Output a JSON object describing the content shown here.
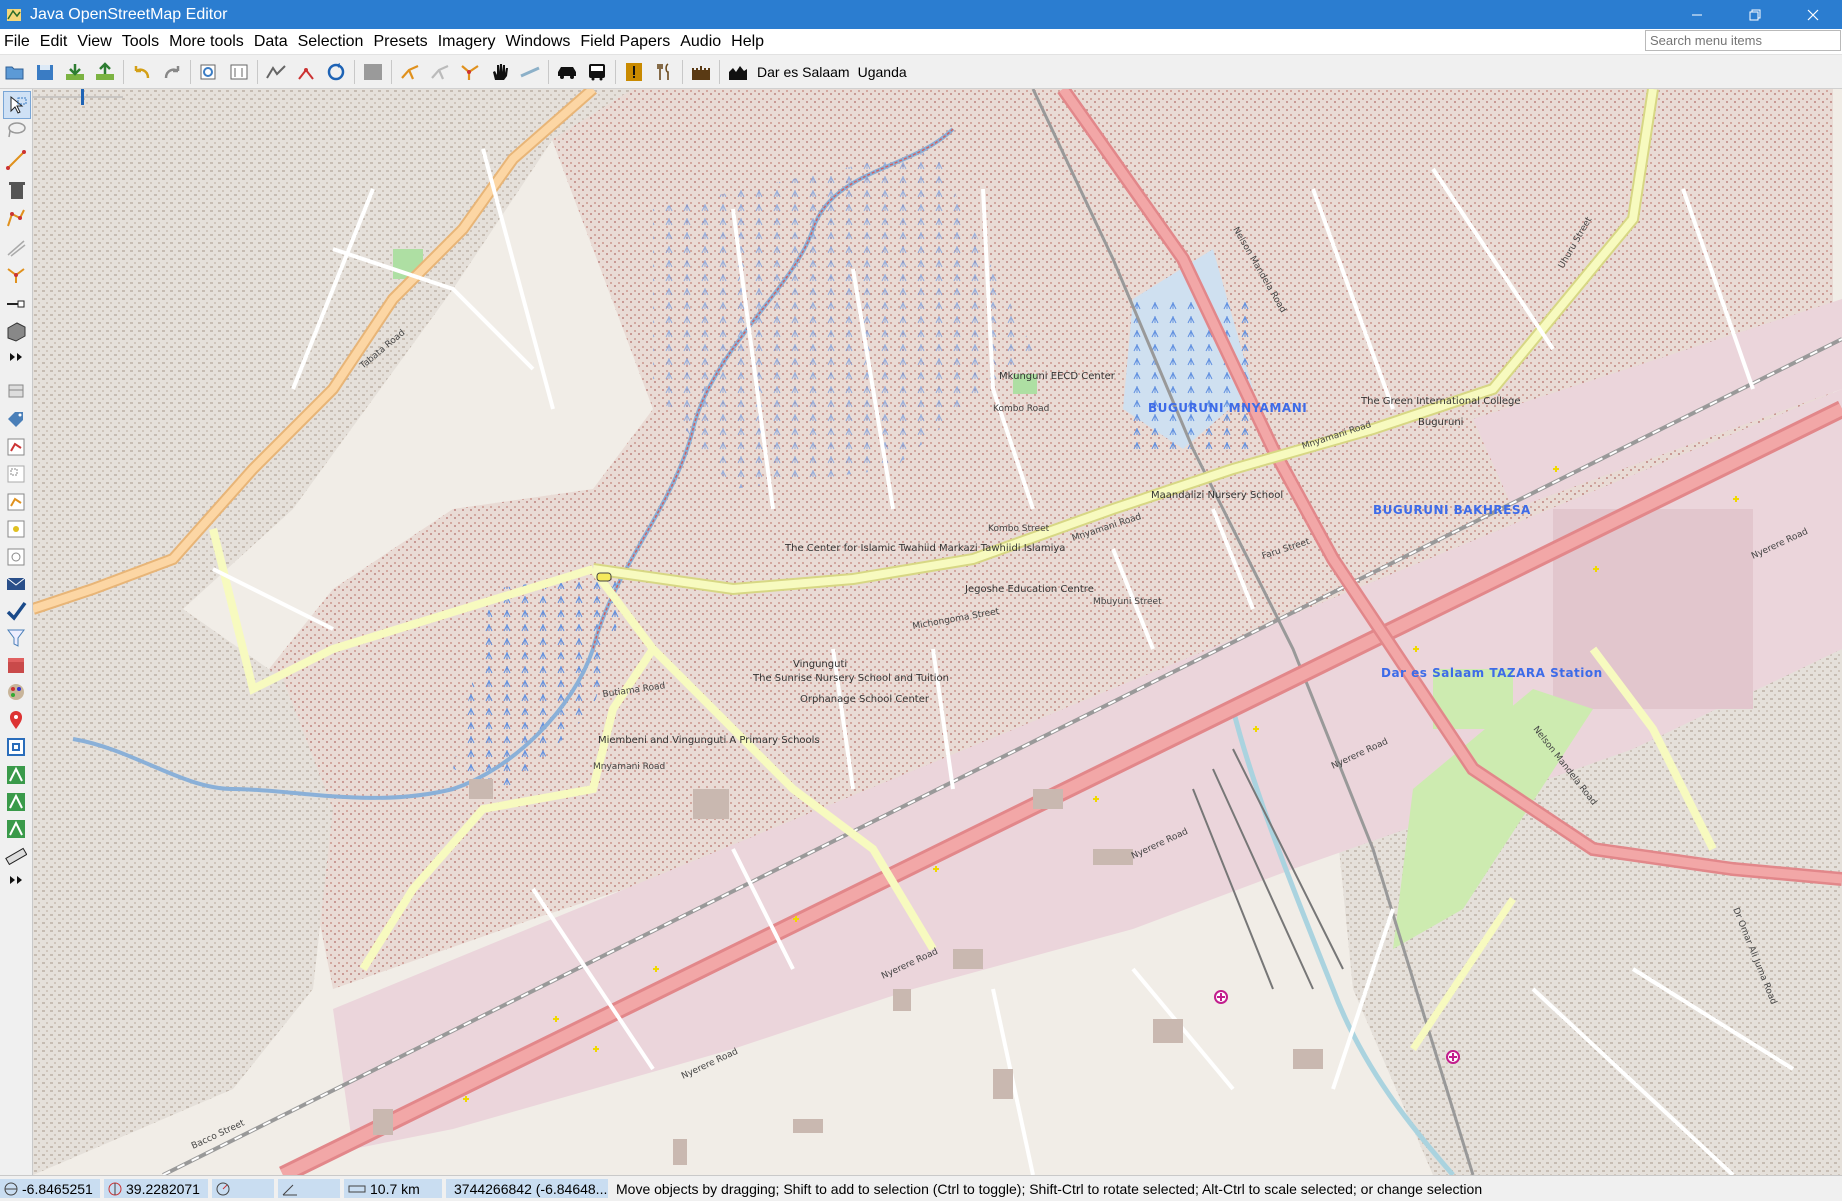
{
  "window": {
    "title": "Java OpenStreetMap Editor"
  },
  "menubar": {
    "items": [
      "File",
      "Edit",
      "View",
      "Tools",
      "More tools",
      "Data",
      "Selection",
      "Presets",
      "Imagery",
      "Windows",
      "Field Papers",
      "Audio",
      "Help"
    ],
    "search_placeholder": "Search menu items"
  },
  "toolbar": {
    "bookmark_1": "Dar es Salaam",
    "bookmark_2": "Uganda"
  },
  "map": {
    "suburbs": {
      "buguruni_mnyamani": "BUGURUNI MNYAMANI",
      "buguruni_bakhresa": "BUGURUNI BAKHRESA",
      "tazara_station": "Dar es Salaam TAZARA Station"
    },
    "places": {
      "buguruni": "Buguruni",
      "vingunguti": "Vingunguti"
    },
    "pois": {
      "mkunguni_eecd": "Mkunguni EECD Center",
      "green_intl_college": "The Green International College",
      "maandalizi": "Maandalizi Nursery School",
      "islamic_center": "The Center for Islamic Twahiid Markazi Tawhiidi Islamiya",
      "jegoshe": "Jegoshe Education Centre",
      "sunrise_nursery": "The Sunrise Nursery School and Tuition",
      "orphanage": "Orphanage School Center",
      "miembeni": "Miembeni and Vingunguti A Primary Schools"
    },
    "roads": {
      "tabata": "Tabata Road",
      "nelson_mandela_1": "Nelson Mandela Road",
      "nelson_mandela_2": "Nelson Mandela Road",
      "nyerere_1": "Nyerere Road",
      "nyerere_2": "Nyerere Road",
      "nyerere_3": "Nyerere Road",
      "nyerere_4": "Nyerere Road",
      "nyerere_5": "Nyerere Road",
      "mnyamani": "Mnyamani Road",
      "mnyamani_2": "Mnyamani Road",
      "uhuru": "Uhuru Street",
      "kombo": "Kombo Road",
      "kombo_street": "Kombo Street",
      "butiama": "Butiama Road",
      "bacco": "Bacco Street",
      "omari_juma": "Dr Omar Ali Juma Road",
      "faru": "Faru Street",
      "mbuyuni": "Mbuyuni Street",
      "michongoma": "Michongoma Street",
      "mnyamani_short": "Mnyamani Road"
    }
  },
  "statusbar": {
    "lat": "-6.8465251",
    "lon": "39.2282071",
    "distance": "10.7 km",
    "object": "3744266842 (-6.84648...",
    "message": "Move objects by dragging; Shift to add to selection (Ctrl to toggle); Shift-Ctrl to rotate selected; Alt-Ctrl to scale selected; or change selection"
  }
}
